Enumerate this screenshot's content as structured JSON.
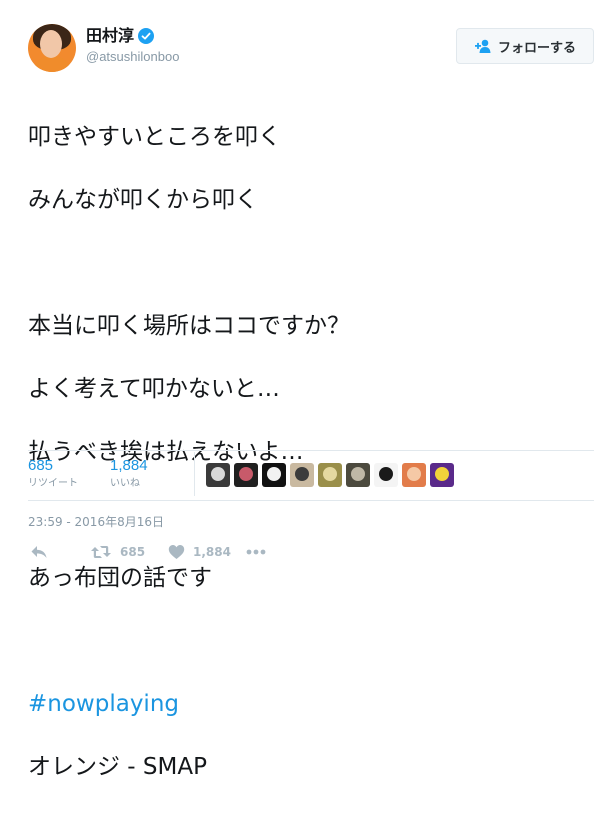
{
  "user": {
    "display_name": "田村淳",
    "handle": "@atsushilonboo",
    "verified": true
  },
  "follow_button": {
    "label": "フォローする",
    "icon": "person-add-icon"
  },
  "tweet": {
    "lines": [
      "叩きやすいところを叩く",
      "みんなが叩くから叩く",
      "",
      "本当に叩く場所はココですか？",
      "よく考えて叩かないと…",
      "払うべき埃は払えないよ…",
      "",
      "あっ布団の話です",
      ""
    ],
    "hashtag": "#nowplaying",
    "last_line": "オレンジ - SMAP"
  },
  "stats": {
    "retweets": {
      "count": "685",
      "label": "リツイート"
    },
    "likes": {
      "count": "1,884",
      "label": "いいね"
    }
  },
  "likers": [
    {
      "name": "liker-avatar-1",
      "colors": [
        "#3a3a3a",
        "#d9d9d9"
      ]
    },
    {
      "name": "liker-avatar-2",
      "colors": [
        "#202020",
        "#c85a6a"
      ]
    },
    {
      "name": "liker-avatar-3",
      "colors": [
        "#111111",
        "#f2f2f2"
      ]
    },
    {
      "name": "liker-avatar-4",
      "colors": [
        "#c9b9a0",
        "#3c3c3c"
      ]
    },
    {
      "name": "liker-avatar-5",
      "colors": [
        "#9a8f4a",
        "#e5d9a0"
      ]
    },
    {
      "name": "liker-avatar-6",
      "colors": [
        "#4c4a3e",
        "#bfb8a6"
      ]
    },
    {
      "name": "liker-avatar-7",
      "colors": [
        "#f4f4f4",
        "#1a1a1a"
      ]
    },
    {
      "name": "liker-avatar-8",
      "colors": [
        "#e27c4a",
        "#f5c9a6"
      ]
    },
    {
      "name": "liker-avatar-9",
      "colors": [
        "#5a2a8a",
        "#f2d23a"
      ]
    }
  ],
  "timestamp": "23:59 - 2016年8月16日",
  "actions": {
    "reply": {
      "icon": "reply-icon"
    },
    "retweet": {
      "icon": "retweet-icon",
      "count": "685"
    },
    "like": {
      "icon": "heart-icon",
      "count": "1,884"
    },
    "more": {
      "icon": "more-icon"
    }
  },
  "colors": {
    "link": "#1b95e0",
    "muted": "#8899a6",
    "action": "#aab8c2"
  }
}
